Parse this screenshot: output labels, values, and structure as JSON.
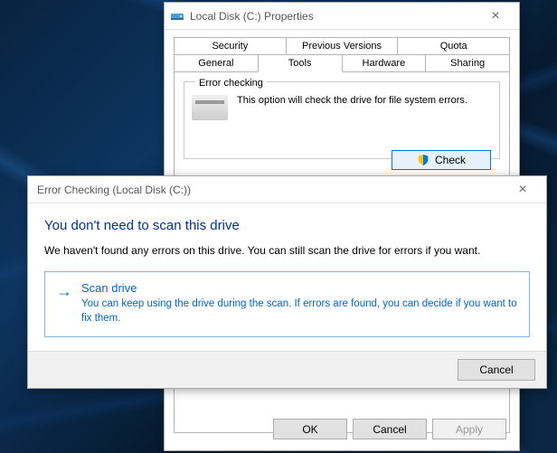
{
  "properties_window": {
    "title": "Local Disk (C:) Properties",
    "tabs_row1": [
      "Security",
      "Previous Versions",
      "Quota"
    ],
    "tabs_row2": [
      "General",
      "Tools",
      "Hardware",
      "Sharing"
    ],
    "active_tab": "Tools",
    "error_checking": {
      "group_title": "Error checking",
      "description": "This option will check the drive for file system errors.",
      "button_label": "Check"
    },
    "buttons": {
      "ok": "OK",
      "cancel": "Cancel",
      "apply": "Apply"
    }
  },
  "error_checking_dialog": {
    "title": "Error Checking (Local Disk (C:))",
    "heading": "You don't need to scan this drive",
    "message": "We haven't found any errors on this drive. You can still scan the drive for errors if you want.",
    "option": {
      "title": "Scan drive",
      "description": "You can keep using the drive during the scan. If errors are found, you can decide if you want to fix them."
    },
    "cancel": "Cancel"
  }
}
